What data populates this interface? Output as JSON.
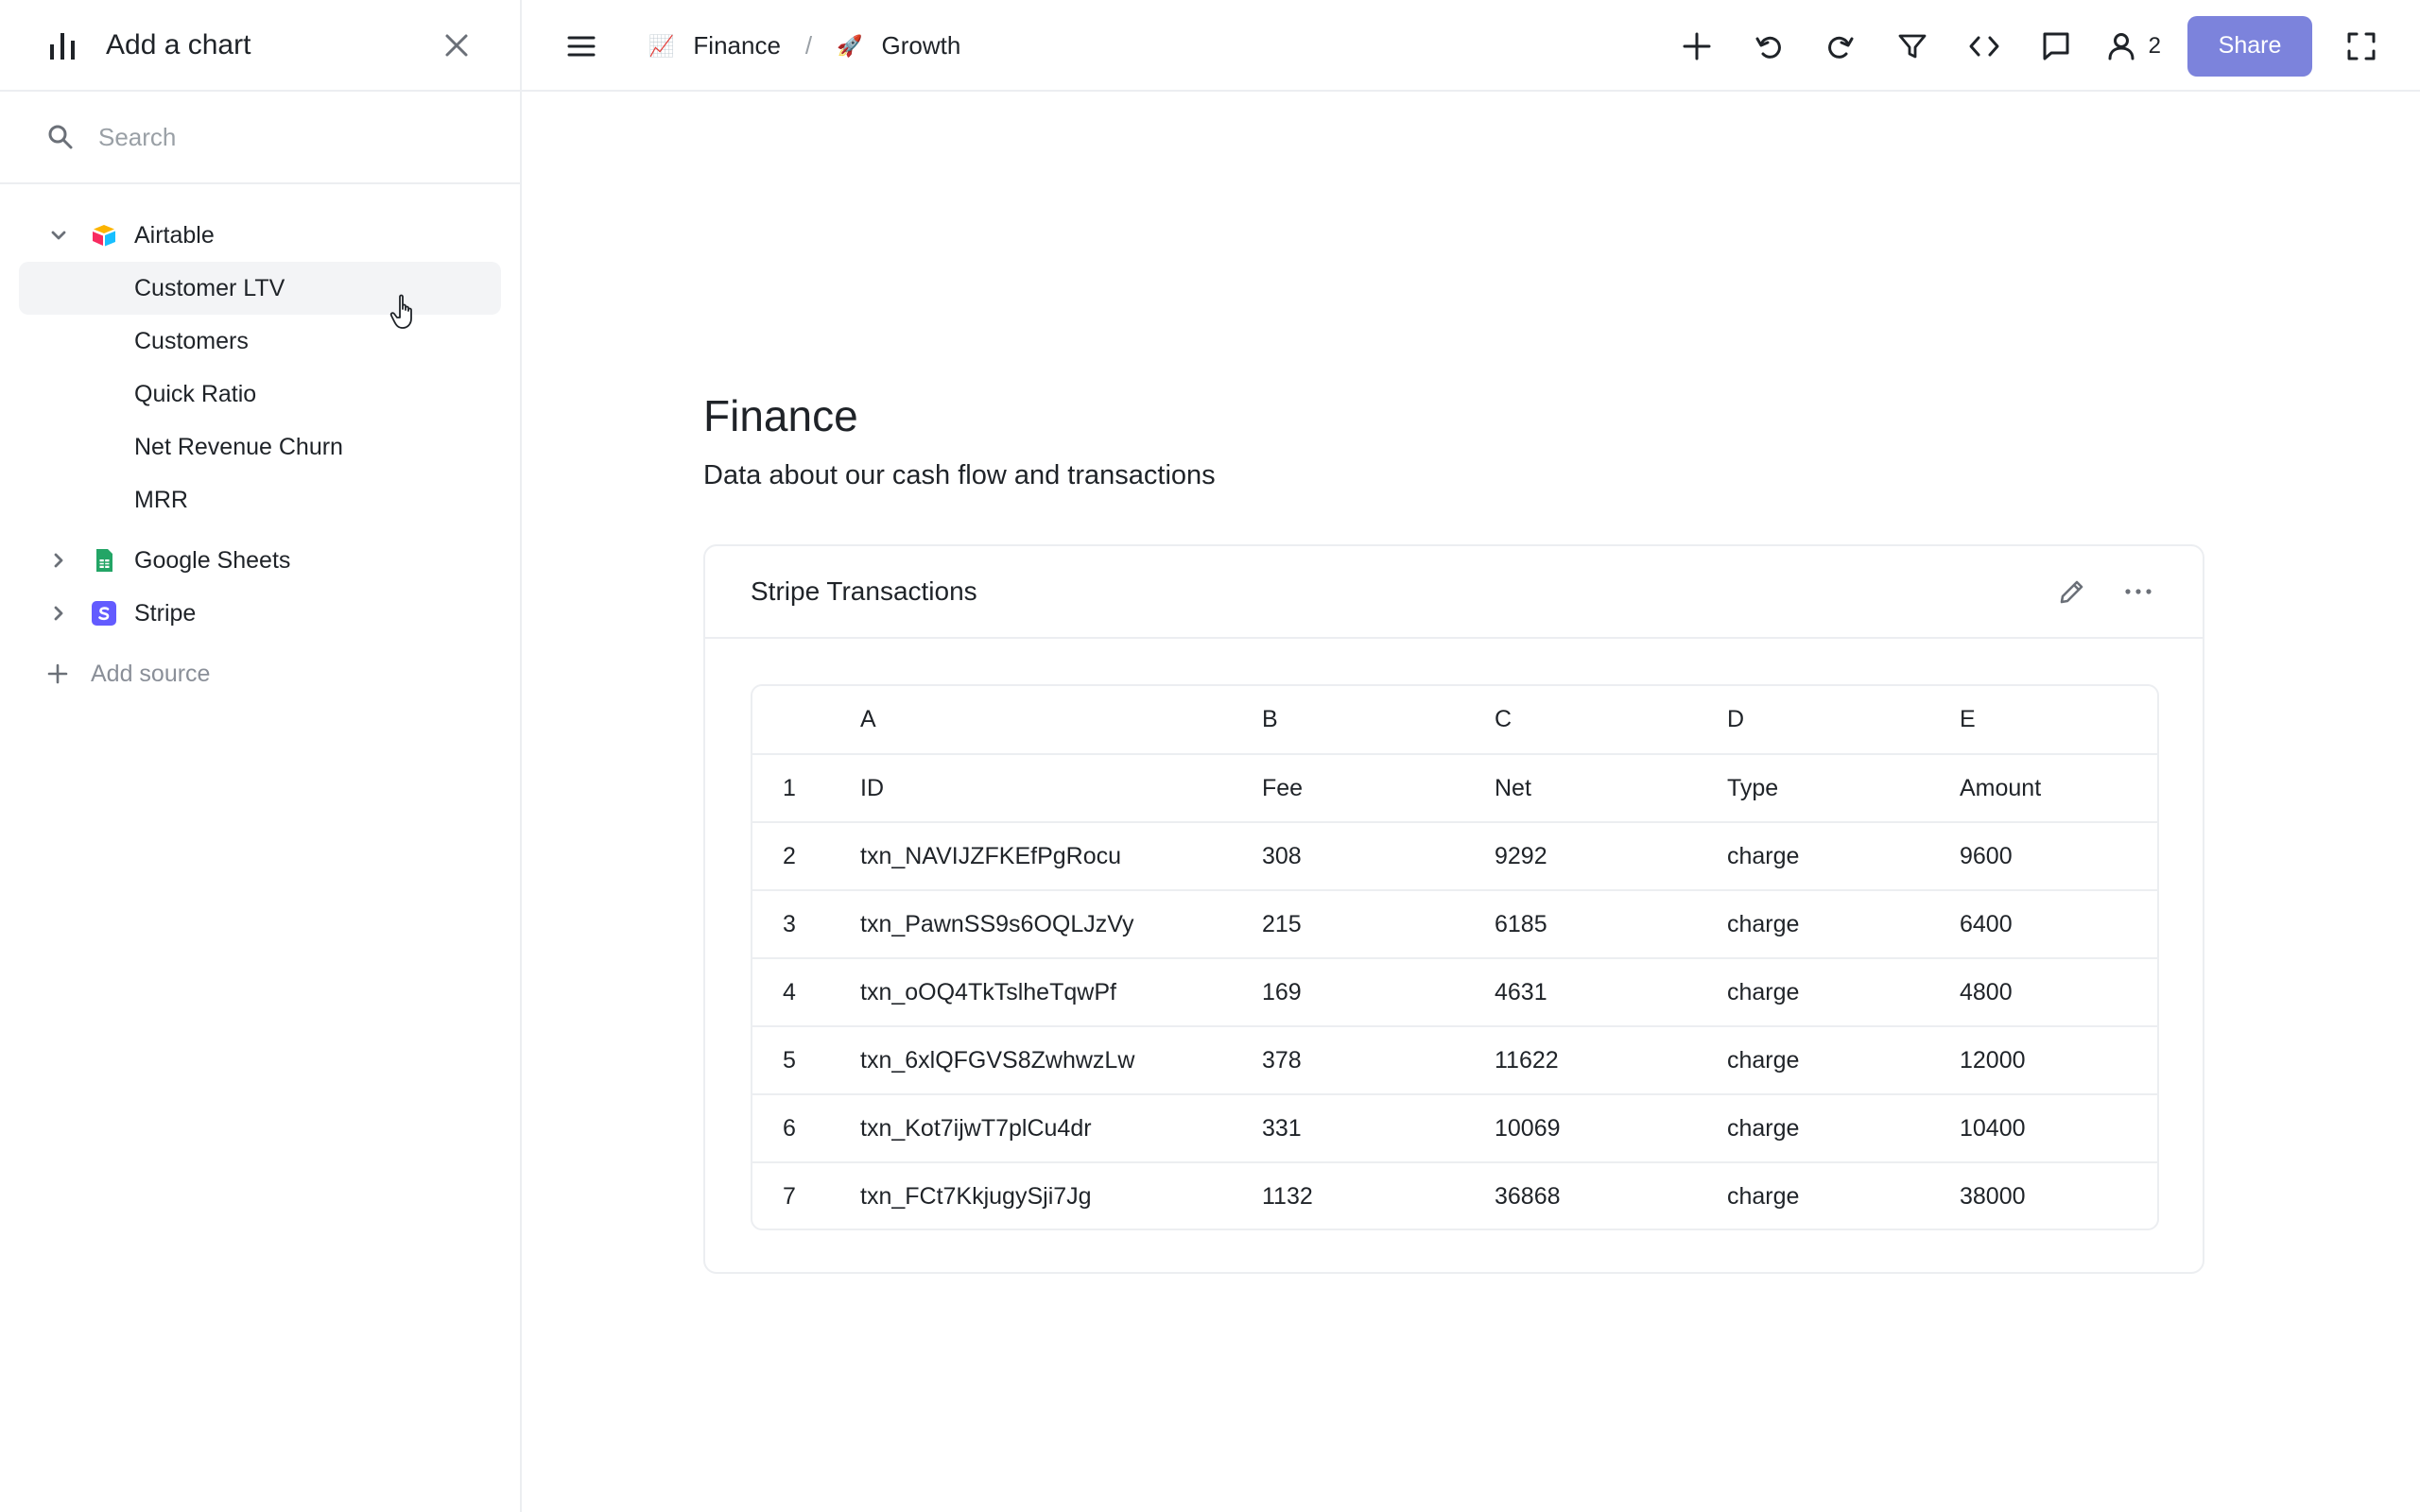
{
  "sidebar": {
    "title": "Add a chart",
    "search_placeholder": "Search",
    "sources": [
      {
        "name": "Airtable",
        "expanded": true,
        "icon": "airtable-icon",
        "items": [
          "Customer LTV",
          "Customers",
          "Quick Ratio",
          "Net Revenue Churn",
          "MRR"
        ]
      },
      {
        "name": "Google Sheets",
        "expanded": false,
        "icon": "google-sheets-icon"
      },
      {
        "name": "Stripe",
        "expanded": false,
        "icon": "stripe-icon"
      }
    ],
    "add_source_label": "Add source",
    "hovered_item": "Customer LTV"
  },
  "topbar": {
    "breadcrumbs": [
      {
        "emoji": "📈",
        "label": "Finance"
      },
      {
        "emoji": "🚀",
        "label": "Growth"
      }
    ],
    "separator": "/",
    "users_count": "2",
    "share_label": "Share",
    "accent_color": "#7c83dc"
  },
  "page": {
    "title": "Finance",
    "subtitle": "Data about our cash flow and transactions"
  },
  "card": {
    "title": "Stripe Transactions",
    "columns": [
      "A",
      "B",
      "C",
      "D",
      "E"
    ],
    "rows": [
      {
        "n": "1",
        "cells": [
          "ID",
          "Fee",
          "Net",
          "Type",
          "Amount"
        ]
      },
      {
        "n": "2",
        "cells": [
          "txn_NAVIJZFKEfPgRocu",
          "308",
          "9292",
          "charge",
          "9600"
        ]
      },
      {
        "n": "3",
        "cells": [
          "txn_PawnSS9s6OQLJzVy",
          "215",
          "6185",
          "charge",
          "6400"
        ]
      },
      {
        "n": "4",
        "cells": [
          "txn_oOQ4TkTslheTqwPf",
          "169",
          "4631",
          "charge",
          "4800"
        ]
      },
      {
        "n": "5",
        "cells": [
          "txn_6xlQFGVS8ZwhwzLw",
          "378",
          "11622",
          "charge",
          "12000"
        ]
      },
      {
        "n": "6",
        "cells": [
          "txn_Kot7ijwT7plCu4dr",
          "331",
          "10069",
          "charge",
          "10400"
        ]
      },
      {
        "n": "7",
        "cells": [
          "txn_FCt7KkjugySji7Jg",
          "1132",
          "36868",
          "charge",
          "38000"
        ]
      }
    ]
  }
}
